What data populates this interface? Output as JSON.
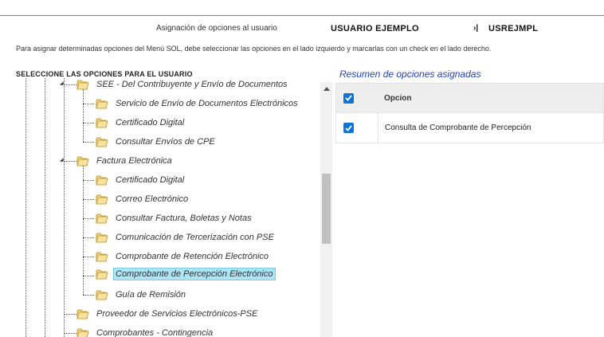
{
  "header": {
    "assign_label": "Asignación de opciones al usuario",
    "user_name": "USUARIO EJEMPLO",
    "separator": "›|",
    "user_code": "USREJMPL"
  },
  "instructions": "Para asignar determinadas opciones del Menú SOL, debe seleccionar las opciones en el lado izquierdo y marcarlas con un check en el lado derecho.",
  "tree": {
    "header": "SELECCIONE LAS OPCIONES PARA EL USUARIO",
    "items": [
      {
        "label": "SEE - Del Contribuyente y Envío de Documentos",
        "level": 1
      },
      {
        "label": "Servicio de Envío de Documentos Electrónicos",
        "level": 2
      },
      {
        "label": "Certificado Digital",
        "level": 2
      },
      {
        "label": "Consultar Envíos de CPE",
        "level": 2
      },
      {
        "label": "Factura Electrónica",
        "level": 1
      },
      {
        "label": "Certificado Digital",
        "level": 2
      },
      {
        "label": "Correo Electrónico",
        "level": 2
      },
      {
        "label": "Consultar Factura, Boletas y Notas",
        "level": 2
      },
      {
        "label": "Comunicación de Tercerización con PSE",
        "level": 2
      },
      {
        "label": "Comprobante de Retención Electrónico",
        "level": 2
      },
      {
        "label": "Comprobante de Percepción Electrónico",
        "level": 2,
        "selected": true
      },
      {
        "label": "Guía de Remisión",
        "level": 2
      },
      {
        "label": "Proveedor de Servicios Electrónicos-PSE",
        "level": 1
      },
      {
        "label": "Comprobantes - Contingencia",
        "level": 1
      }
    ]
  },
  "summary": {
    "title": "Resumen de opciones asignadas",
    "column_header": "Opcion",
    "rows": [
      {
        "label": "Consulta de Comprobante de Percepción",
        "checked": true
      }
    ]
  },
  "colors": {
    "accent_blue": "#0b75d9",
    "selection_bg": "#aee4f3",
    "summary_title": "#1f3fbf"
  }
}
